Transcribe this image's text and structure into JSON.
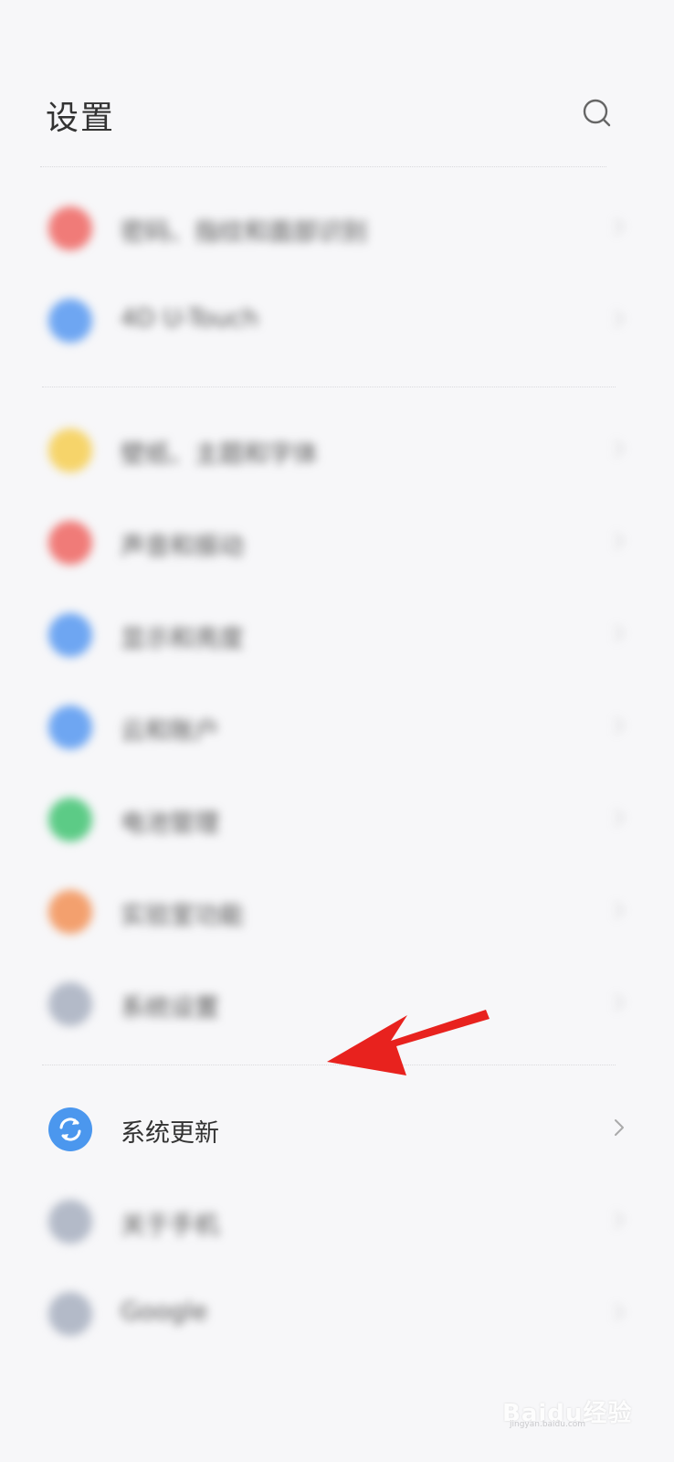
{
  "header": {
    "title": "设置",
    "search_icon": "search-icon"
  },
  "groups": [
    {
      "items": [
        {
          "label": "密码、指纹和面部识别",
          "color": "#f07b78",
          "blurred": true
        },
        {
          "label": "4D U-Touch",
          "color": "#6ea6f2",
          "blurred": true
        }
      ]
    },
    {
      "items": [
        {
          "label": "壁纸、主题和字体",
          "color": "#f6d46a",
          "blurred": true
        },
        {
          "label": "声音和振动",
          "color": "#f07b78",
          "blurred": true
        },
        {
          "label": "显示和亮度",
          "color": "#6ea6f2",
          "blurred": true
        },
        {
          "label": "云和账户",
          "color": "#6ea6f2",
          "blurred": true
        },
        {
          "label": "电池管理",
          "color": "#5ccb86",
          "blurred": true
        },
        {
          "label": "实验室功能",
          "color": "#f3a06e",
          "blurred": true
        },
        {
          "label": "系统设置",
          "color": "#b3bac8",
          "blurred": true
        }
      ]
    },
    {
      "items": [
        {
          "label": "系统更新",
          "color": "#4b97ee",
          "blurred": false,
          "icon": "refresh-icon"
        },
        {
          "label": "关于手机",
          "color": "#b3bac8",
          "blurred": true
        },
        {
          "label": "Google",
          "color": "#b3bac8",
          "blurred": true
        }
      ]
    }
  ],
  "annotation": {
    "arrow_color": "#e8221e"
  },
  "watermark": {
    "text": "Baidu经验",
    "sub": "jingyan.baidu.com"
  }
}
